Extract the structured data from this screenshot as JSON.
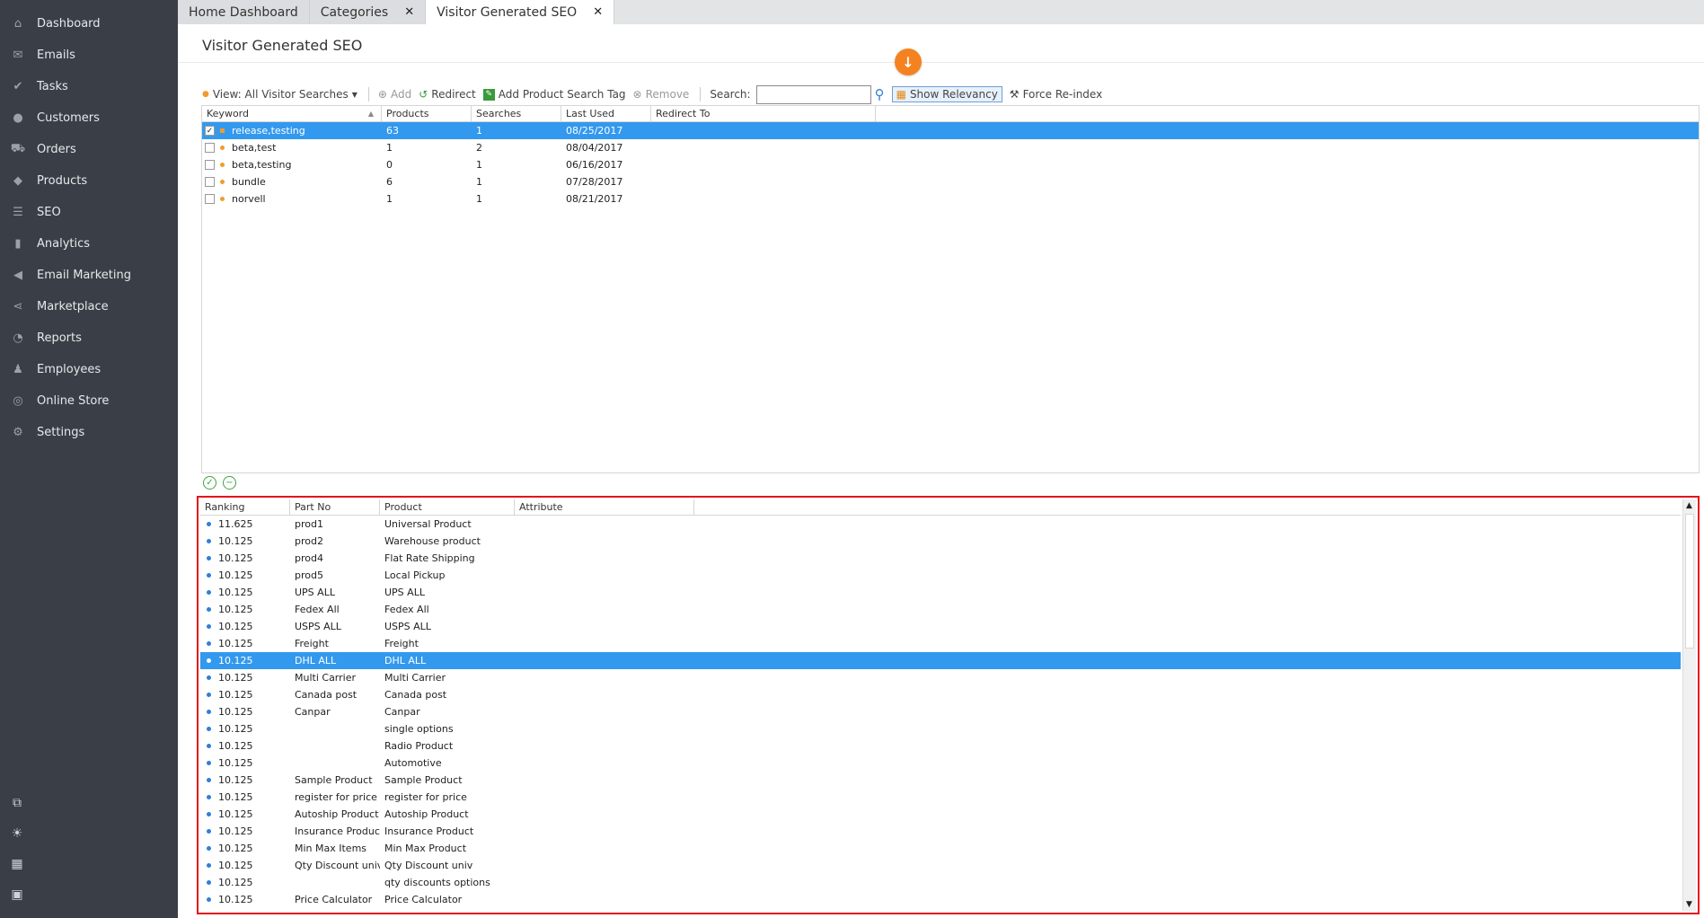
{
  "sidebar": {
    "items": [
      {
        "label": "Dashboard",
        "icon": "home-icon"
      },
      {
        "label": "Emails",
        "icon": "envelope-icon"
      },
      {
        "label": "Tasks",
        "icon": "tasks-icon"
      },
      {
        "label": "Customers",
        "icon": "person-icon"
      },
      {
        "label": "Orders",
        "icon": "cart-icon"
      },
      {
        "label": "Products",
        "icon": "tag-icon"
      },
      {
        "label": "SEO",
        "icon": "sliders-icon"
      },
      {
        "label": "Analytics",
        "icon": "bar-chart-icon"
      },
      {
        "label": "Email Marketing",
        "icon": "megaphone-icon"
      },
      {
        "label": "Marketplace",
        "icon": "share-icon"
      },
      {
        "label": "Reports",
        "icon": "pie-chart-icon"
      },
      {
        "label": "Employees",
        "icon": "group-icon"
      },
      {
        "label": "Online Store",
        "icon": "globe-icon"
      },
      {
        "label": "Settings",
        "icon": "search-gear-icon"
      }
    ]
  },
  "tabs": [
    {
      "label": "Home Dashboard",
      "closable": false,
      "active": false
    },
    {
      "label": "Categories",
      "closable": true,
      "active": false
    },
    {
      "label": "Visitor Generated SEO",
      "closable": true,
      "active": true
    }
  ],
  "page": {
    "title": "Visitor Generated SEO"
  },
  "toolbar": {
    "view": "View: All Visitor Searches",
    "add": "Add",
    "redirect": "Redirect",
    "add_tag": "Add Product Search Tag",
    "remove": "Remove",
    "search_label": "Search:",
    "search_value": "",
    "show_relevancy": "Show Relevancy",
    "force_reindex": "Force Re-index"
  },
  "upper_grid": {
    "headers": [
      "Keyword",
      "Products",
      "Searches",
      "Last Used",
      "Redirect To"
    ],
    "rows": [
      {
        "keyword": "release,testing",
        "products": "63",
        "searches": "1",
        "last_used": "08/25/2017",
        "redirect": "",
        "checked": true,
        "selected": true
      },
      {
        "keyword": "beta,test",
        "products": "1",
        "searches": "2",
        "last_used": "08/04/2017",
        "redirect": "",
        "checked": false,
        "selected": false
      },
      {
        "keyword": "beta,testing",
        "products": "0",
        "searches": "1",
        "last_used": "06/16/2017",
        "redirect": "",
        "checked": false,
        "selected": false
      },
      {
        "keyword": "bundle",
        "products": "6",
        "searches": "1",
        "last_used": "07/28/2017",
        "redirect": "",
        "checked": false,
        "selected": false
      },
      {
        "keyword": "norvell",
        "products": "1",
        "searches": "1",
        "last_used": "08/21/2017",
        "redirect": "",
        "checked": false,
        "selected": false
      }
    ]
  },
  "lower_grid": {
    "headers": [
      "Ranking",
      "Part No",
      "Product",
      "Attribute"
    ],
    "rows": [
      {
        "ranking": "11.625",
        "part": "prod1",
        "product": "Universal Product",
        "attribute": ""
      },
      {
        "ranking": "10.125",
        "part": "prod2",
        "product": "Warehouse product",
        "attribute": ""
      },
      {
        "ranking": "10.125",
        "part": "prod4",
        "product": "Flat Rate Shipping",
        "attribute": ""
      },
      {
        "ranking": "10.125",
        "part": "prod5",
        "product": "Local Pickup",
        "attribute": ""
      },
      {
        "ranking": "10.125",
        "part": "UPS ALL",
        "product": "UPS ALL",
        "attribute": ""
      },
      {
        "ranking": "10.125",
        "part": "Fedex All",
        "product": "Fedex All",
        "attribute": ""
      },
      {
        "ranking": "10.125",
        "part": "USPS ALL",
        "product": "USPS ALL",
        "attribute": ""
      },
      {
        "ranking": "10.125",
        "part": "Freight",
        "product": "Freight",
        "attribute": ""
      },
      {
        "ranking": "10.125",
        "part": "DHL ALL",
        "product": "DHL ALL",
        "attribute": "",
        "selected": true
      },
      {
        "ranking": "10.125",
        "part": "Multi Carrier",
        "product": "Multi Carrier",
        "attribute": ""
      },
      {
        "ranking": "10.125",
        "part": "Canada post",
        "product": "Canada post",
        "attribute": ""
      },
      {
        "ranking": "10.125",
        "part": "Canpar",
        "product": "Canpar",
        "attribute": ""
      },
      {
        "ranking": "10.125",
        "part": "",
        "product": "single options",
        "attribute": ""
      },
      {
        "ranking": "10.125",
        "part": "",
        "product": "Radio Product",
        "attribute": ""
      },
      {
        "ranking": "10.125",
        "part": "",
        "product": "Automotive",
        "attribute": ""
      },
      {
        "ranking": "10.125",
        "part": "Sample Product",
        "product": "Sample Product",
        "attribute": ""
      },
      {
        "ranking": "10.125",
        "part": "register for price",
        "product": "register for price",
        "attribute": ""
      },
      {
        "ranking": "10.125",
        "part": "Autoship Product",
        "product": "Autoship Product",
        "attribute": ""
      },
      {
        "ranking": "10.125",
        "part": "Insurance Product",
        "product": "Insurance Product",
        "attribute": ""
      },
      {
        "ranking": "10.125",
        "part": "Min Max Items",
        "product": "Min Max Product",
        "attribute": ""
      },
      {
        "ranking": "10.125",
        "part": "Qty Discount univ",
        "product": "Qty Discount univ",
        "attribute": ""
      },
      {
        "ranking": "10.125",
        "part": "",
        "product": "qty discounts options",
        "attribute": ""
      },
      {
        "ranking": "10.125",
        "part": "Price Calculator",
        "product": "Price Calculator",
        "attribute": ""
      }
    ]
  },
  "colors": {
    "sidebar": "#3a3f47",
    "selection": "#3399ee",
    "accent": "#f58220",
    "highlight_border": "#e3141b"
  }
}
